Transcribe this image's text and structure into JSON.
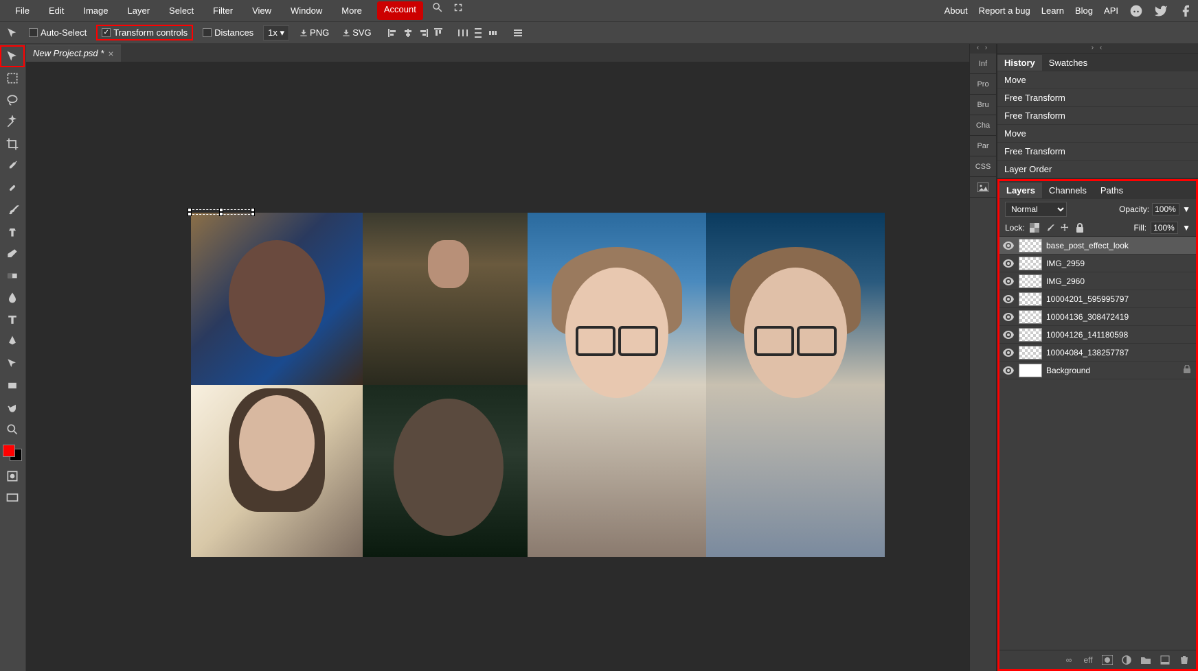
{
  "menubar": {
    "items": [
      "File",
      "Edit",
      "Image",
      "Layer",
      "Select",
      "Filter",
      "View",
      "Window",
      "More"
    ],
    "account": "Account",
    "right": [
      "About",
      "Report a bug",
      "Learn",
      "Blog",
      "API"
    ]
  },
  "options_bar": {
    "auto_select": "Auto-Select",
    "transform_controls": "Transform controls",
    "distances": "Distances",
    "ratio": "1x",
    "png": "PNG",
    "svg": "SVG"
  },
  "document": {
    "tab_name": "New Project.psd *"
  },
  "side_tabs": [
    "Inf",
    "Pro",
    "Bru",
    "Cha",
    "Par",
    "CSS"
  ],
  "history_panel": {
    "tabs": [
      "History",
      "Swatches"
    ],
    "items": [
      "Move",
      "Free Transform",
      "Free Transform",
      "Move",
      "Free Transform",
      "Layer Order"
    ]
  },
  "layers_panel": {
    "tabs": [
      "Layers",
      "Channels",
      "Paths"
    ],
    "blend_mode": "Normal",
    "opacity_label": "Opacity:",
    "opacity_value": "100%",
    "lock_label": "Lock:",
    "fill_label": "Fill:",
    "fill_value": "100%",
    "layers": [
      {
        "name": "base_post_effect_look",
        "selected": true,
        "locked": false,
        "thumb": "checker"
      },
      {
        "name": "IMG_2959",
        "selected": false,
        "locked": false,
        "thumb": "checker"
      },
      {
        "name": "IMG_2960",
        "selected": false,
        "locked": false,
        "thumb": "checker"
      },
      {
        "name": "10004201_595995797",
        "selected": false,
        "locked": false,
        "thumb": "img"
      },
      {
        "name": "10004136_308472419",
        "selected": false,
        "locked": false,
        "thumb": "img"
      },
      {
        "name": "10004126_141180598",
        "selected": false,
        "locked": false,
        "thumb": "img"
      },
      {
        "name": "10004084_138257787",
        "selected": false,
        "locked": false,
        "thumb": "checker"
      },
      {
        "name": "Background",
        "selected": false,
        "locked": true,
        "thumb": "white"
      }
    ],
    "footer_labels": {
      "link": "∞",
      "fx": "eff"
    }
  },
  "colors": {
    "foreground": "#ff0000",
    "background": "#000000"
  }
}
